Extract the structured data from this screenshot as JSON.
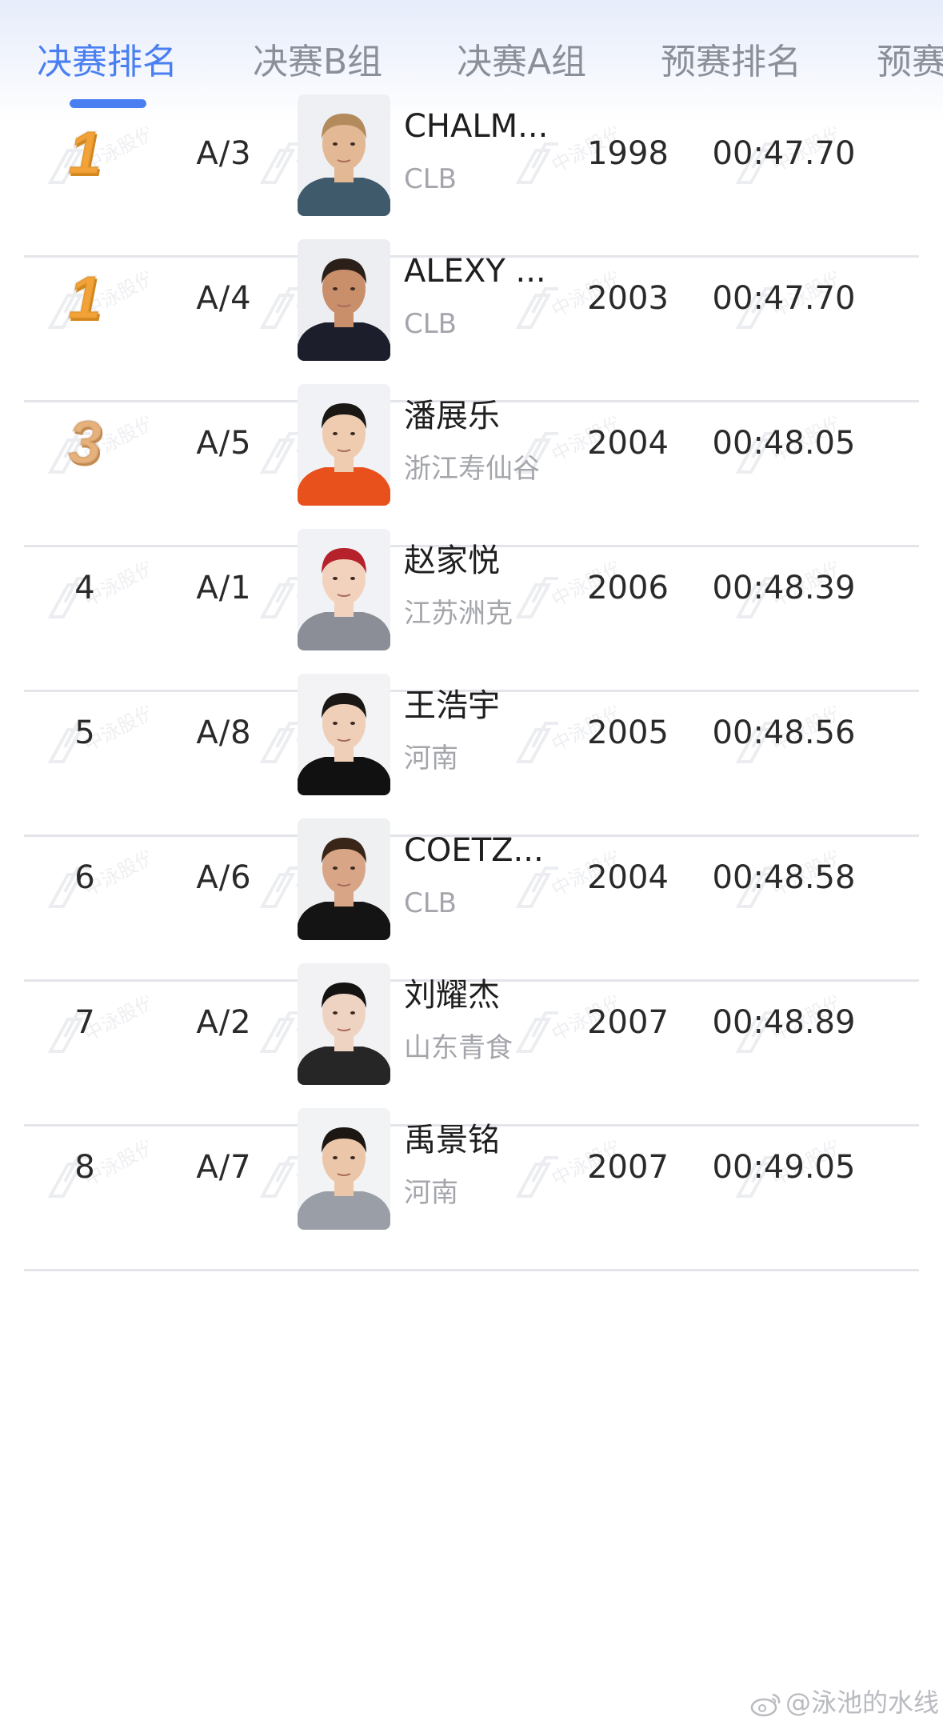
{
  "tabs": [
    {
      "label": "决赛排名",
      "active": true
    },
    {
      "label": "决赛B组",
      "active": false
    },
    {
      "label": "决赛A组",
      "active": false
    },
    {
      "label": "预赛排名",
      "active": false
    },
    {
      "label": "预赛",
      "active": false
    }
  ],
  "watermark_text": "中泳股份",
  "results": [
    {
      "rank": "1",
      "medal": "gold",
      "lane": "A/3",
      "name": "CHALM...",
      "team": "CLB",
      "birth_year": "1998",
      "time": "00:47.70",
      "avatar": {
        "hair": "#b28a5c",
        "skin": "#e3b894",
        "shirt": "#3e5a6b",
        "bg": "#eef0f3"
      }
    },
    {
      "rank": "1",
      "medal": "gold",
      "lane": "A/4",
      "name": "ALEXY ...",
      "team": "CLB",
      "birth_year": "2003",
      "time": "00:47.70",
      "avatar": {
        "hair": "#2a2019",
        "skin": "#c98f6b",
        "shirt": "#1c1e2b",
        "bg": "#eceef2"
      }
    },
    {
      "rank": "3",
      "medal": "bronze",
      "lane": "A/5",
      "name": "潘展乐",
      "team": "浙江寿仙谷",
      "birth_year": "2004",
      "time": "00:48.05",
      "avatar": {
        "hair": "#1b1714",
        "skin": "#efcbb0",
        "shirt": "#e8501c",
        "bg": "#f1f2f5"
      }
    },
    {
      "rank": "4",
      "medal": "",
      "lane": "A/1",
      "name": "赵家悦",
      "team": "江苏洲克",
      "birth_year": "2006",
      "time": "00:48.39",
      "avatar": {
        "hair": "#b5222c",
        "skin": "#f2d2bd",
        "shirt": "#8b8e96",
        "bg": "#f1f2f5"
      }
    },
    {
      "rank": "5",
      "medal": "",
      "lane": "A/8",
      "name": "王浩宇",
      "team": "河南",
      "birth_year": "2005",
      "time": "00:48.56",
      "avatar": {
        "hair": "#1a1714",
        "skin": "#efcfb8",
        "shirt": "#111111",
        "bg": "#f3f3f5"
      }
    },
    {
      "rank": "6",
      "medal": "",
      "lane": "A/6",
      "name": "COETZ...",
      "team": "CLB",
      "birth_year": "2004",
      "time": "00:48.58",
      "avatar": {
        "hair": "#3a2618",
        "skin": "#d8a587",
        "shirt": "#141414",
        "bg": "#eef0f2"
      }
    },
    {
      "rank": "7",
      "medal": "",
      "lane": "A/2",
      "name": "刘耀杰",
      "team": "山东青食",
      "birth_year": "2007",
      "time": "00:48.89",
      "avatar": {
        "hair": "#151312",
        "skin": "#efd3c2",
        "shirt": "#262626",
        "bg": "#f2f2f4"
      }
    },
    {
      "rank": "8",
      "medal": "",
      "lane": "A/7",
      "name": "禹景铭",
      "team": "河南",
      "birth_year": "2007",
      "time": "00:49.05",
      "avatar": {
        "hair": "#1c1713",
        "skin": "#ecc6a8",
        "shirt": "#9a9ea6",
        "bg": "#f2f3f5"
      }
    }
  ],
  "footer": {
    "credit": "@泳池的水线"
  }
}
